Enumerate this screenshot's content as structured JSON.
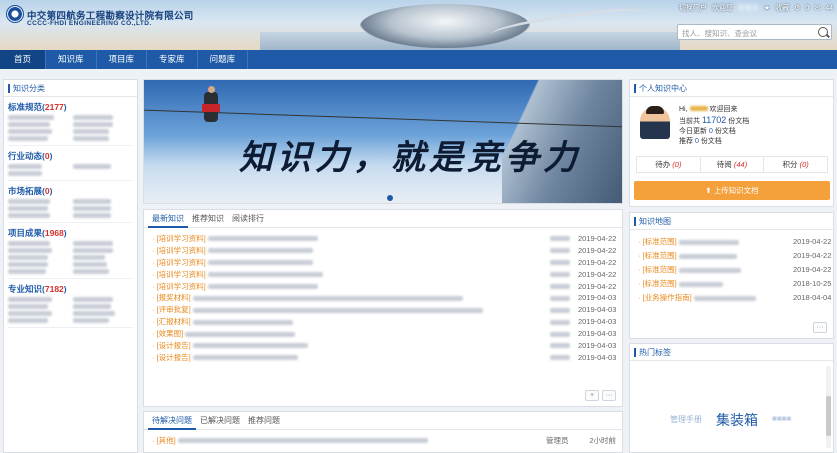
{
  "header": {
    "logo_cn": "中交第四航务工程勘察设计院有限公司",
    "logo_en": "CCCC-FHDI ENGINEERING CO.,LTD.",
    "top_links": {
      "portal": "切换门户",
      "welcome": "欢迎您",
      "fav": "收藏",
      "badge1": "0",
      "badge2": "44"
    },
    "search_placeholder": "找人、搜知识、查会议"
  },
  "nav": [
    "首页",
    "知识库",
    "项目库",
    "专家库",
    "问题库"
  ],
  "left": {
    "title": "知识分类",
    "cats": [
      {
        "name": "标准规范",
        "count": "2177"
      },
      {
        "name": "行业动态",
        "count": "0"
      },
      {
        "name": "市场拓展",
        "count": "0"
      },
      {
        "name": "项目成果",
        "count": "1968"
      },
      {
        "name": "专业知识",
        "count": "7182"
      }
    ]
  },
  "banner": {
    "slogan": "知识力，就是竞争力"
  },
  "mid": {
    "tabs": [
      "最新知识",
      "推荐知识",
      "阅读排行"
    ],
    "rows": [
      {
        "tag": "[培训学习资料]",
        "date": "2019-04-22"
      },
      {
        "tag": "[培训学习资料]",
        "date": "2019-04-22"
      },
      {
        "tag": "[培训学习资料]",
        "date": "2019-04-22"
      },
      {
        "tag": "[培训学习资料]",
        "date": "2019-04-22"
      },
      {
        "tag": "[培训学习资料]",
        "date": "2019-04-22"
      },
      {
        "tag": "[报奖材料]",
        "date": "2019-04-03"
      },
      {
        "tag": "[评审批复]",
        "date": "2019-04-03"
      },
      {
        "tag": "[汇报材料]",
        "date": "2019-04-03"
      },
      {
        "tag": "[效果图]",
        "date": "2019-04-03"
      },
      {
        "tag": "[设计报告]",
        "date": "2019-04-03"
      },
      {
        "tag": "[设计报告]",
        "date": "2019-04-03"
      }
    ],
    "more": "+",
    "dots": "···"
  },
  "bot": {
    "tabs": [
      "待解决问题",
      "已解决问题",
      "推荐问题"
    ],
    "row": {
      "tag": "[其他]",
      "author": "管理员",
      "time": "2小时前"
    }
  },
  "personal": {
    "title": "个人知识中心",
    "hi": "Hi,",
    "welcome_back": "欢迎回来",
    "total_prefix": "当前共",
    "total": "11702",
    "total_suffix": "份文档",
    "today_prefix": "今日更新",
    "today": "0",
    "today_suffix": "份文档",
    "rec_prefix": "推荐",
    "rec": "0",
    "rec_suffix": "份文档",
    "stats": [
      {
        "label": "待办",
        "val": "(0)"
      },
      {
        "label": "待阅",
        "val": "(44)"
      },
      {
        "label": "积分",
        "val": "(0)"
      }
    ],
    "upload": "上传知识文档"
  },
  "map": {
    "title": "知识地图",
    "rows": [
      {
        "tag": "[标准范围]",
        "date": "2019-04-22"
      },
      {
        "tag": "[标准范围]",
        "date": "2019-04-22"
      },
      {
        "tag": "[标准范围]",
        "date": "2019-04-22"
      },
      {
        "tag": "[标准范围]",
        "date": "2018-10-25"
      },
      {
        "tag": "[业务操作指南]",
        "date": "2018-04-04"
      }
    ],
    "dots": "···"
  },
  "tags": {
    "title": "热门标签",
    "t1": "管理手册",
    "t2": "集装箱"
  },
  "colors": {
    "primary": "#1e5aa8",
    "accent": "#e8891c",
    "red": "#d4322c",
    "upload": "#f4a03b"
  }
}
